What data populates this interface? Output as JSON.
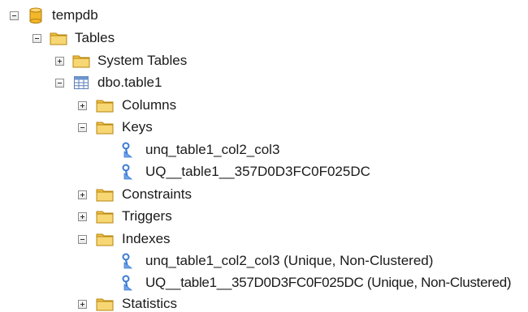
{
  "tree": {
    "database": "tempdb",
    "tables_folder": "Tables",
    "system_tables": "System Tables",
    "table": "dbo.table1",
    "columns": "Columns",
    "keys": "Keys",
    "key_items": [
      "unq_table1_col2_col3",
      "UQ__table1__357D0D3FC0F025DC"
    ],
    "constraints": "Constraints",
    "triggers": "Triggers",
    "indexes": "Indexes",
    "index_items": [
      "unq_table1_col2_col3 (Unique, Non-Clustered)",
      "UQ__table1__357D0D3FC0F025DC (Unique, Non-Clustered)"
    ],
    "statistics": "Statistics"
  },
  "colors": {
    "folder": "#f0c04a",
    "database": "#f2b82a",
    "key_icon": "#3a7bd5"
  }
}
